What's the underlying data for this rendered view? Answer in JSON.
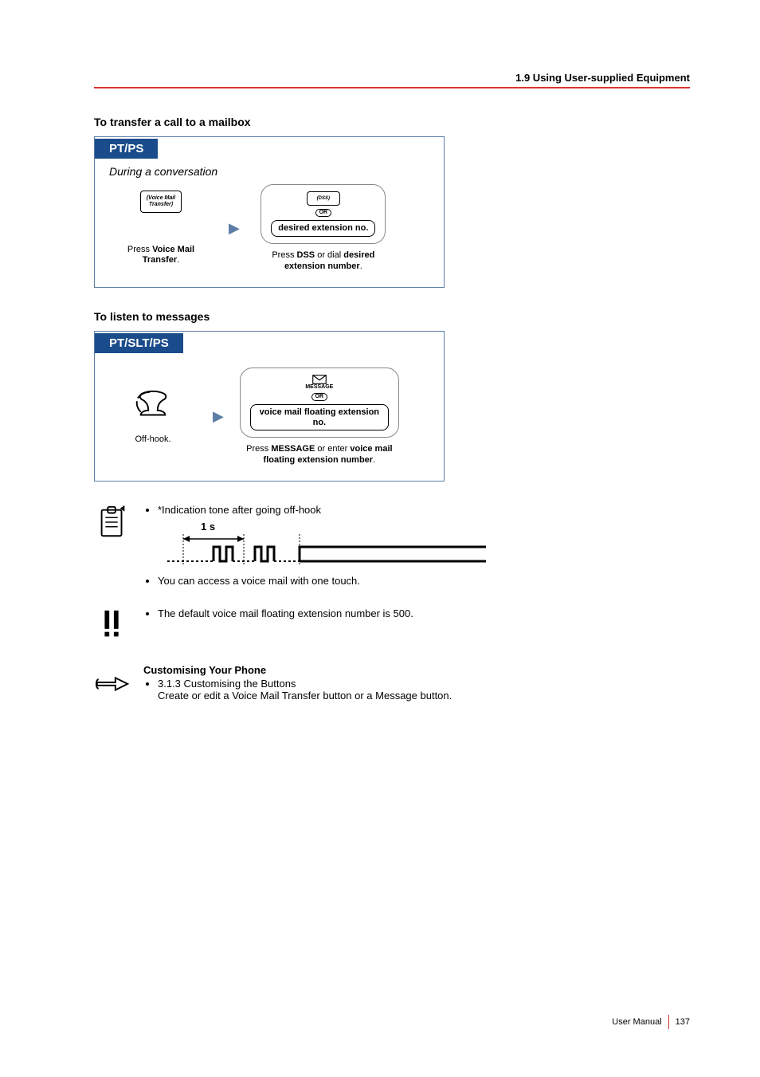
{
  "header": {
    "breadcrumb": "1.9 Using User-supplied Equipment"
  },
  "section1": {
    "title": "To transfer a call to a mailbox",
    "tab": "PT/PS",
    "context": "During a conversation",
    "step1_icon_label": "(Voice Mail Transfer)",
    "step1_caption_pre": "Press ",
    "step1_caption_bold": "Voice Mail Transfer",
    "step1_caption_post": ".",
    "step2_topicon": "(DSS)",
    "or_label": "OR",
    "step2_option": "desired extension no.",
    "step2_caption": "Press <b>DSS</b> or dial <b>desired extension number</b>."
  },
  "section2": {
    "title": "To listen to messages",
    "tab": "PT/SLT/PS",
    "step1_caption": "Off-hook.",
    "msg_label": "MESSAGE",
    "or_label": "OR",
    "step2_option": "voice mail floating extension no.",
    "step2_caption": "Press <b>MESSAGE</b> or enter <b>voice mail floating extension number</b>."
  },
  "notes1": {
    "bullet1": "*Indication tone after going off-hook",
    "tone_label": "1 s",
    "bullet2": "You can access a voice mail with one touch."
  },
  "notes2": {
    "bullet1": "The default voice mail floating extension number is 500."
  },
  "customise": {
    "title": "Customising Your Phone",
    "line1": "3.1.3 Customising the Buttons",
    "line2": "Create or edit a Voice Mail Transfer button or a Message button."
  },
  "footer": {
    "label": "User Manual",
    "page": "137"
  }
}
